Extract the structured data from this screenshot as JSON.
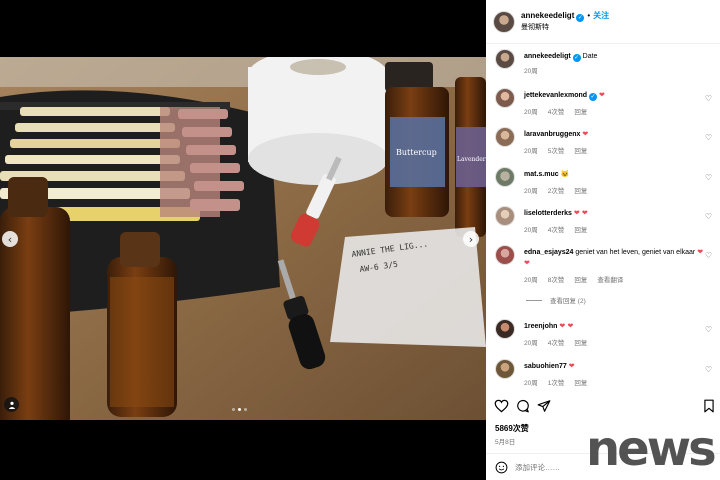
{
  "post": {
    "author": "annekeedeligt",
    "follow_label": "关注",
    "separator": "•",
    "location": "曼彻斯特",
    "caption_text": "Date",
    "caption_time": "20周",
    "likes": "5869次赞",
    "date": "5月8日",
    "comment_placeholder": "添加评论……"
  },
  "media": {
    "label_line1": "ANNIE THE LIG...",
    "label_line2": "AW-6  3/5",
    "bottle_label": "Buttercup",
    "bottle_label_small": "Lavender"
  },
  "comments": [
    {
      "user": "jettekevanlexmond",
      "verified": true,
      "text": "",
      "emoji": "❤",
      "time": "20周",
      "likes": "4次赞",
      "reply": "回复"
    },
    {
      "user": "laravanbruggenx",
      "verified": false,
      "text": "",
      "emoji": "❤",
      "time": "20周",
      "likes": "5次赞",
      "reply": "回复"
    },
    {
      "user": "mat.s.muc",
      "verified": false,
      "text": "",
      "emoji": "🐱",
      "time": "20周",
      "likes": "2次赞",
      "reply": "回复"
    },
    {
      "user": "liselotterderks",
      "verified": false,
      "text": "",
      "emoji": "❤ ❤",
      "time": "20周",
      "likes": "4次赞",
      "reply": "回复"
    },
    {
      "user": "edna_esjays24",
      "verified": false,
      "text": "geniet van het leven, geniet van elkaar",
      "emoji": "❤ ❤",
      "time": "20周",
      "likes": "8次赞",
      "reply": "回复",
      "translate": "查看翻译"
    },
    {
      "user": "1reenjohn",
      "verified": false,
      "text": "",
      "emoji": "❤ ❤",
      "time": "20周",
      "likes": "4次赞",
      "reply": "回复"
    },
    {
      "user": "sabuohien77",
      "verified": false,
      "text": "",
      "emoji": "❤",
      "time": "20周",
      "likes": "1次赞",
      "reply": "回复"
    }
  ],
  "view_replies": "查看回复 (2)",
  "icons": [
    "chevron-left-icon",
    "chevron-right-icon",
    "user-tag-icon",
    "heart-icon",
    "comment-icon",
    "share-icon",
    "bookmark-icon",
    "emoji-icon"
  ],
  "colors": {
    "link": "#0095f6",
    "heart": "#ed4956",
    "verified": "#0095f6"
  },
  "watermark": "news"
}
